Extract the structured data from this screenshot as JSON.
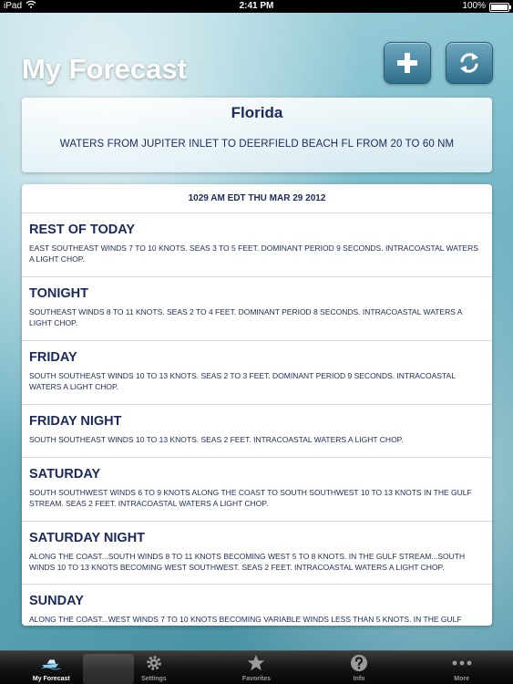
{
  "status": {
    "device": "iPad",
    "time": "2:41 PM",
    "battery": "100%",
    "battery_level": 1.0
  },
  "header": {
    "title": "My Forecast"
  },
  "location": {
    "name": "Florida",
    "description": "WATERS FROM JUPITER INLET TO DEERFIELD BEACH FL FROM 20 TO 60 NM"
  },
  "forecast": {
    "issued": "1029 AM EDT THU MAR 29 2012",
    "periods": [
      {
        "name": "REST OF TODAY",
        "text": "EAST SOUTHEAST WINDS 7 TO 10 KNOTS. SEAS 3 TO 5 FEET. DOMINANT PERIOD 9 SECONDS. INTRACOASTAL WATERS A LIGHT CHOP."
      },
      {
        "name": "TONIGHT",
        "text": "SOUTHEAST WINDS 8 TO 11 KNOTS. SEAS 2 TO 4 FEET. DOMINANT PERIOD 8 SECONDS. INTRACOASTAL WATERS A LIGHT CHOP."
      },
      {
        "name": "FRIDAY",
        "text": "SOUTH SOUTHEAST WINDS 10 TO 13 KNOTS. SEAS 2 TO 3 FEET. DOMINANT PERIOD 9 SECONDS. INTRACOASTAL WATERS A LIGHT CHOP."
      },
      {
        "name": "FRIDAY NIGHT",
        "text": "SOUTH SOUTHEAST WINDS 10 TO 13 KNOTS. SEAS 2 FEET. INTRACOASTAL WATERS A LIGHT CHOP."
      },
      {
        "name": "SATURDAY",
        "text": "SOUTH SOUTHWEST WINDS 6 TO 9 KNOTS ALONG THE COAST TO SOUTH SOUTHWEST 10 TO 13 KNOTS IN THE GULF STREAM. SEAS 2 FEET. INTRACOASTAL WATERS A LIGHT CHOP."
      },
      {
        "name": "SATURDAY NIGHT",
        "text": "ALONG THE COAST...SOUTH WINDS 8 TO 11 KNOTS BECOMING WEST 5 TO 8 KNOTS. IN THE GULF STREAM...SOUTH WINDS 10 TO 13 KNOTS BECOMING WEST SOUTHWEST. SEAS 2 FEET. INTRACOASTAL WATERS A LIGHT CHOP."
      },
      {
        "name": "SUNDAY",
        "text": "ALONG THE COAST...WEST WINDS 7 TO 10 KNOTS BECOMING VARIABLE WINDS LESS THAN 5 KNOTS. IN THE GULF"
      }
    ]
  },
  "tabs": [
    {
      "label": "My Forecast",
      "icon": "boat-icon",
      "active": true
    },
    {
      "label": "Settings",
      "icon": "gear-icon",
      "active": false
    },
    {
      "label": "Favorites",
      "icon": "star-icon",
      "active": false
    },
    {
      "label": "Info",
      "icon": "question-icon",
      "active": false
    },
    {
      "label": "More",
      "icon": "more-dots-icon",
      "active": false
    }
  ],
  "colors": {
    "accent": "#1b2a5a",
    "button": "#2f6f8c"
  }
}
